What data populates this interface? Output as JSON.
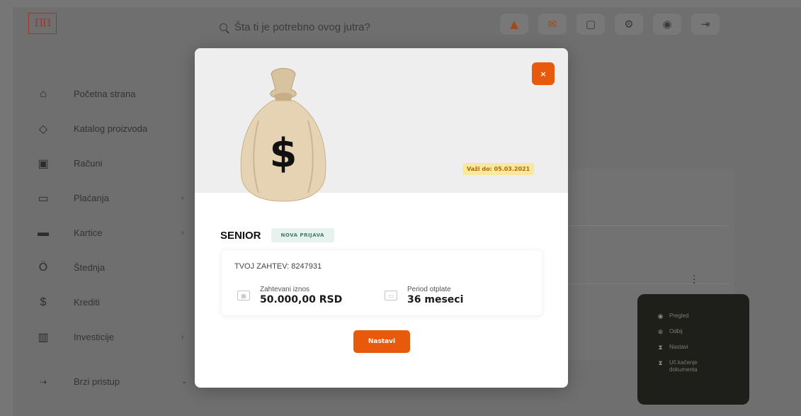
{
  "app": {
    "logo_text": "ΠΠ"
  },
  "search": {
    "placeholder": "Šta ti je potrebno ovog jutra?"
  },
  "topbar": {
    "icons": [
      "offer-bag-icon",
      "mail-icon",
      "document-icon",
      "settings-icon",
      "profile-icon",
      "logout-icon"
    ]
  },
  "sidebar": {
    "items": [
      {
        "label": "Početna strana",
        "icon": "home-icon",
        "has_chevron": false
      },
      {
        "label": "Katalog proizvoda",
        "icon": "tag-icon",
        "has_chevron": false
      },
      {
        "label": "Računi",
        "icon": "wallet-icon",
        "has_chevron": false
      },
      {
        "label": "Plaćanja",
        "icon": "payments-icon",
        "has_chevron": true
      },
      {
        "label": "Kartice",
        "icon": "card-icon",
        "has_chevron": true
      },
      {
        "label": "Štednja",
        "icon": "savings-icon",
        "has_chevron": false
      },
      {
        "label": "Krediti",
        "icon": "loan-icon",
        "has_chevron": false
      },
      {
        "label": "Investicije",
        "icon": "investments-icon",
        "has_chevron": true
      },
      {
        "label": "Brzi pristup",
        "icon": "quick-access-icon",
        "has_chevron": true
      }
    ]
  },
  "context_menu": {
    "items": [
      {
        "label": "Pregled",
        "icon": "eye-icon"
      },
      {
        "label": "Odbij",
        "icon": "x-circle-icon"
      },
      {
        "label": "Nastavi",
        "icon": "hourglass-icon"
      },
      {
        "label": "Uč.kačenje dokumenta",
        "icon": "hourglass-icon"
      }
    ]
  },
  "modal": {
    "close_label": "×",
    "valid_until": "Važi do: 05.03.2021",
    "title": "SENIOR",
    "status_badge": "NOVA PRIJAVA",
    "request_label": "TVOJ ZAHTEV: 8247931",
    "amount_label": "Zahtevani iznos",
    "amount_value": "50.000,00 RSD",
    "period_label": "Period otplate",
    "period_value": "36 meseci",
    "cta_label": "Nastavi"
  },
  "colors": {
    "accent": "#e8590c",
    "overlay": "#6f6f6f",
    "badge_new_bg": "#e7f1ee",
    "valid_badge_bg": "#f8e8a0"
  }
}
